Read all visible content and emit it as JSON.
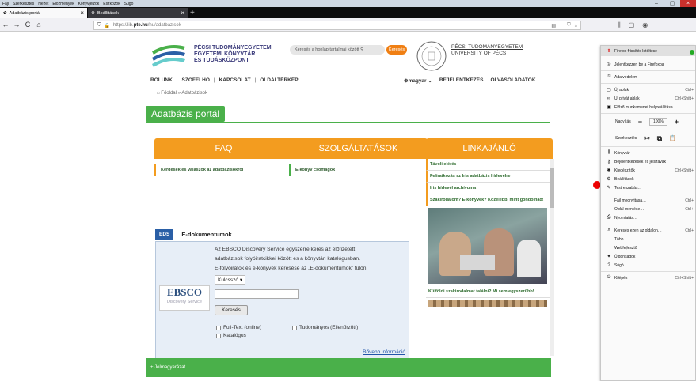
{
  "menubar": [
    "Fájl",
    "Szerkesztés",
    "Nézet",
    "Előzmények",
    "Könyvjelzők",
    "Eszközök",
    "Súgó"
  ],
  "tabs": [
    {
      "label": "Adatbázis portál",
      "close": "×"
    },
    {
      "label": "Beállítások",
      "close": "×"
    }
  ],
  "nav": {
    "back": "←",
    "forward": "→",
    "reload": "C",
    "home": "⌂",
    "url_prefix": "https://lib.",
    "url_domain": "pte.hu",
    "url_path": "/hu/adatbazisok"
  },
  "header": {
    "org_line1": "PÉCSI TUDOMÁNYEGYETEM",
    "org_line2": "EGYETEMI KÖNYVTÁR",
    "org_line3": "ÉS TUDÁSKÖZPONT",
    "search_placeholder": "Keresés a honlap tartalmai között",
    "search_btn": "Keresés",
    "uni_line1": "PÉCSI TUDOMÁNYEGYETEM",
    "uni_line2": "UNIVERSITY OF PÉCS",
    "nav_items": [
      "RÓLUNK",
      "SZÓFELHŐ",
      "KAPCSOLAT",
      "OLDALTÉRKÉP"
    ],
    "lang": "magyar",
    "login": "BEJELENTKEZÉS",
    "reader": "OLVASÓI ADATOK"
  },
  "breadcrumb": {
    "home": "Főoldal",
    "current": "Adatbázisok"
  },
  "portal_title": "Adatbázis portál",
  "cards": {
    "faq": {
      "title": "FAQ",
      "item": "Kérdések és válaszok az adatbázisokról"
    },
    "services": {
      "title": "SZOLGÁLTATÁSOK",
      "item": "E-könyv csomagok"
    },
    "links": {
      "title": "LINKAJÁNLÓ",
      "items": [
        "Távoli elérés",
        "Feliratkozás az Iris adatbázis hírlevélre",
        "Iris hírlevél archívuma",
        "Szakirodalom? E-könyvek? Közelebb, mint gondolnád!",
        "Külföldi szakirodalmat találni? Mi sem egyszerűbb!"
      ]
    }
  },
  "eds": {
    "label": "EDS",
    "title": "E-dokumentumok",
    "desc1": "Az EBSCO Discovery Service egyszerre keres az előfizetett",
    "desc2": "adatbázisok folyóiratcikkei között és a könyvtári katalógusban.",
    "desc3": "E-folyóiratok és e-könyvek keresése az „E-dokumentumok” fülön.",
    "keyword": "Kulcsszó",
    "logo_name": "EBSCO",
    "logo_sub": "Discovery Service",
    "search_btn": "Keresés",
    "cb_fulltext": "Full-Text (online)",
    "cb_scholarly": "Tudományos (Ellenőrzött)",
    "cb_catalog": "Katalógus",
    "more": "Bővebb információ"
  },
  "footer": "+ Jelmagyarázat",
  "menu": {
    "items": [
      {
        "label": "Firefox frissítés letöltése",
        "icon": "⬆",
        "sc": ""
      },
      {
        "label": "Jelentkezzen be a Firefoxba",
        "icon": "①",
        "sc": ""
      },
      {
        "label": "Adatvédelem",
        "icon": "⚿",
        "sc": ""
      },
      {
        "label": "Új ablak",
        "icon": "▢",
        "sc": "Ctrl+"
      },
      {
        "label": "Új privát ablak",
        "icon": "∞",
        "sc": "Ctrl+Shift+"
      },
      {
        "label": "Előző munkamenet helyreállítása",
        "icon": "▣",
        "sc": ""
      },
      {
        "label": "Könyvtár",
        "icon": "⫼",
        "sc": ""
      },
      {
        "label": "Bejelentkezések és jelszavak",
        "icon": "⚷",
        "sc": ""
      },
      {
        "label": "Kiegészítők",
        "icon": "✱",
        "sc": "Ctrl+Shift+"
      },
      {
        "label": "Beállítások",
        "icon": "⚙",
        "sc": ""
      },
      {
        "label": "Testreszabás…",
        "icon": "✎",
        "sc": ""
      },
      {
        "label": "Fájl megnyitása…",
        "icon": "",
        "sc": "Ctrl+"
      },
      {
        "label": "Oldal mentése…",
        "icon": "",
        "sc": "Ctrl+"
      },
      {
        "label": "Nyomtatás…",
        "icon": "⎙",
        "sc": ""
      },
      {
        "label": "Keresés ezen az oldalon…",
        "icon": "⌕",
        "sc": "Ctrl+"
      },
      {
        "label": "Több",
        "icon": "",
        "sc": ""
      },
      {
        "label": "Webfejlesztő",
        "icon": "",
        "sc": ""
      },
      {
        "label": "Újdonságok",
        "icon": "✦",
        "sc": ""
      },
      {
        "label": "Súgó",
        "icon": "?",
        "sc": ""
      },
      {
        "label": "Kilépés",
        "icon": "⏻",
        "sc": "Ctrl+Shift+"
      }
    ],
    "zoom_label": "Nagyítás",
    "zoom_minus": "−",
    "zoom_value": "100%",
    "zoom_plus": "+",
    "edit_label": "Szerkesztés",
    "cut": "✂",
    "copy": "⧉",
    "paste": "📋"
  }
}
